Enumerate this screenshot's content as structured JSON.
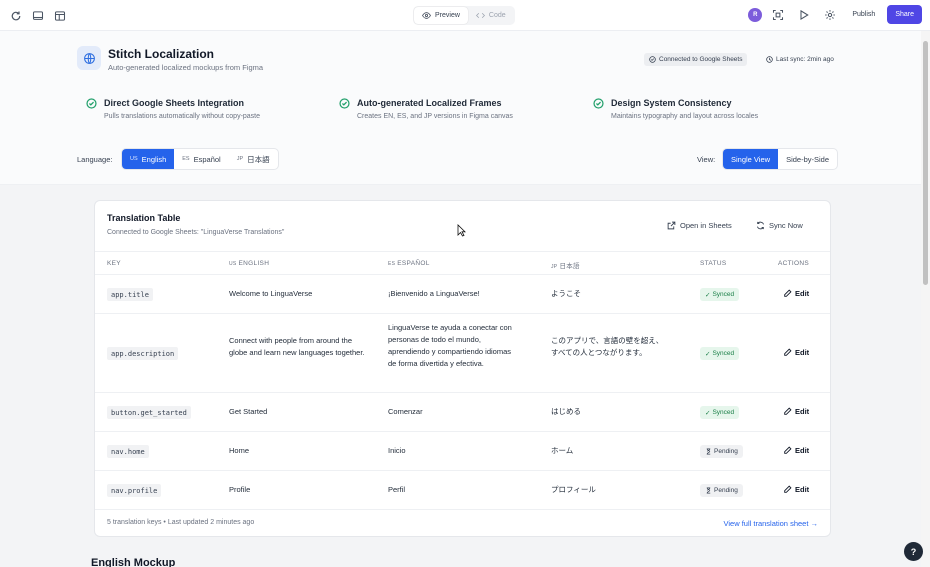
{
  "topbar": {
    "preview_label": "Preview",
    "code_label": "Code",
    "avatar_initial": "R",
    "publish_label": "Publish",
    "share_label": "Share"
  },
  "header": {
    "title": "Stitch Localization",
    "subtitle": "Auto-generated localized mockups from Figma",
    "connection_status": "Connected to Google Sheets",
    "last_sync": "Last sync: 2min ago"
  },
  "features": [
    {
      "title": "Direct Google Sheets Integration",
      "desc": "Pulls translations automatically without copy-paste"
    },
    {
      "title": "Auto-generated Localized Frames",
      "desc": "Creates EN, ES, and JP versions in Figma canvas"
    },
    {
      "title": "Design System Consistency",
      "desc": "Maintains typography and layout across locales"
    }
  ],
  "language": {
    "label": "Language:",
    "options": [
      {
        "code": "US",
        "name": "English",
        "active": true
      },
      {
        "code": "ES",
        "name": "Español",
        "active": false
      },
      {
        "code": "JP",
        "name": "日本語",
        "active": false
      }
    ]
  },
  "view": {
    "label": "View:",
    "options": [
      {
        "name": "Single View",
        "active": true
      },
      {
        "name": "Side-by-Side",
        "active": false
      }
    ]
  },
  "table": {
    "title": "Translation Table",
    "subtitle": "Connected to Google Sheets: \"LinguaVerse Translations\"",
    "open_sheets_label": "Open in Sheets",
    "sync_label": "Sync Now",
    "columns": {
      "key": "KEY",
      "en_code": "US",
      "en": "ENGLISH",
      "es_code": "ES",
      "es": "ESPAÑOL",
      "jp_code": "JP",
      "jp": "日本語",
      "status": "STATUS",
      "actions": "ACTIONS"
    },
    "rows": [
      {
        "key": "app.title",
        "en": "Welcome to LinguaVerse",
        "es": "¡Bienvenido a LinguaVerse!",
        "jp": "ようこそ",
        "status": "Synced",
        "action": "Edit"
      },
      {
        "key": "app.description",
        "en": "Connect with people from around the globe and learn new languages together.",
        "es": "LinguaVerse te ayuda a conectar con personas de todo el mundo, aprendiendo y compartiendo idiomas de forma divertida y efectiva.",
        "jp": "このアプリで、言語の壁を超え、すべての人とつながります。",
        "status": "Synced",
        "action": "Edit"
      },
      {
        "key": "button.get_started",
        "en": "Get Started",
        "es": "Comenzar",
        "jp": "はじめる",
        "status": "Synced",
        "action": "Edit"
      },
      {
        "key": "nav.home",
        "en": "Home",
        "es": "Inicio",
        "jp": "ホーム",
        "status": "Pending",
        "action": "Edit"
      },
      {
        "key": "nav.profile",
        "en": "Profile",
        "es": "Perfil",
        "jp": "プロフィール",
        "status": "Pending",
        "action": "Edit"
      }
    ],
    "footer_left": "5 translation keys • Last updated 2 minutes ago",
    "footer_right": "View full translation sheet →"
  },
  "section": {
    "title": "English Mockup"
  },
  "help_label": "?",
  "colors": {
    "accent": "#2563eb",
    "share": "#4f46e5",
    "success": "#22a06b",
    "synced_bg": "#e6f6ec",
    "pending_bg": "#f0f1f3"
  }
}
